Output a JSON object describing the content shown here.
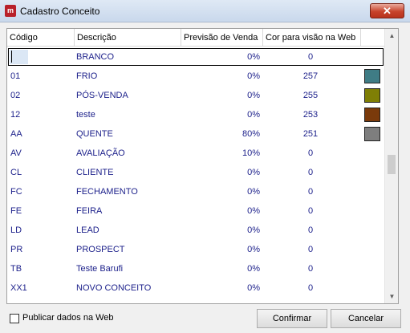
{
  "window": {
    "title": "Cadastro Conceito",
    "close_label": "✕"
  },
  "app_icon_glyph": "m",
  "table": {
    "columns": [
      "Código",
      "Descrição",
      "Previsão de Venda",
      "Cor para visão na Web"
    ],
    "rows": [
      {
        "code": "",
        "desc": "BRANCO",
        "prev": "0%",
        "cor": "0",
        "swatch": null
      },
      {
        "code": "01",
        "desc": "FRIO",
        "prev": "0%",
        "cor": "257",
        "swatch": "#3f7c85"
      },
      {
        "code": "02",
        "desc": "PÓS-VENDA",
        "prev": "0%",
        "cor": "255",
        "swatch": "#7f7f05"
      },
      {
        "code": "12",
        "desc": "teste",
        "prev": "0%",
        "cor": "253",
        "swatch": "#7a3a0b"
      },
      {
        "code": "AA",
        "desc": "QUENTE",
        "prev": "80%",
        "cor": "251",
        "swatch": "#7e7e7e"
      },
      {
        "code": "AV",
        "desc": "AVALIAÇÃO",
        "prev": "10%",
        "cor": "0",
        "swatch": null
      },
      {
        "code": "CL",
        "desc": "CLIENTE",
        "prev": "0%",
        "cor": "0",
        "swatch": null
      },
      {
        "code": "FC",
        "desc": "FECHAMENTO",
        "prev": "0%",
        "cor": "0",
        "swatch": null
      },
      {
        "code": "FE",
        "desc": "FEIRA",
        "prev": "0%",
        "cor": "0",
        "swatch": null
      },
      {
        "code": "LD",
        "desc": "LEAD",
        "prev": "0%",
        "cor": "0",
        "swatch": null
      },
      {
        "code": "PR",
        "desc": "PROSPECT",
        "prev": "0%",
        "cor": "0",
        "swatch": null
      },
      {
        "code": "TB",
        "desc": "Teste Barufi",
        "prev": "0%",
        "cor": "0",
        "swatch": null
      },
      {
        "code": "XX1",
        "desc": "NOVO CONCEITO",
        "prev": "0%",
        "cor": "0",
        "swatch": null
      }
    ]
  },
  "scroll": {
    "up_glyph": "▲",
    "down_glyph": "▼"
  },
  "publish_checkbox": {
    "label": "Publicar dados na Web",
    "checked": false
  },
  "buttons": {
    "confirm": "Confirmar",
    "cancel": "Cancelar"
  }
}
